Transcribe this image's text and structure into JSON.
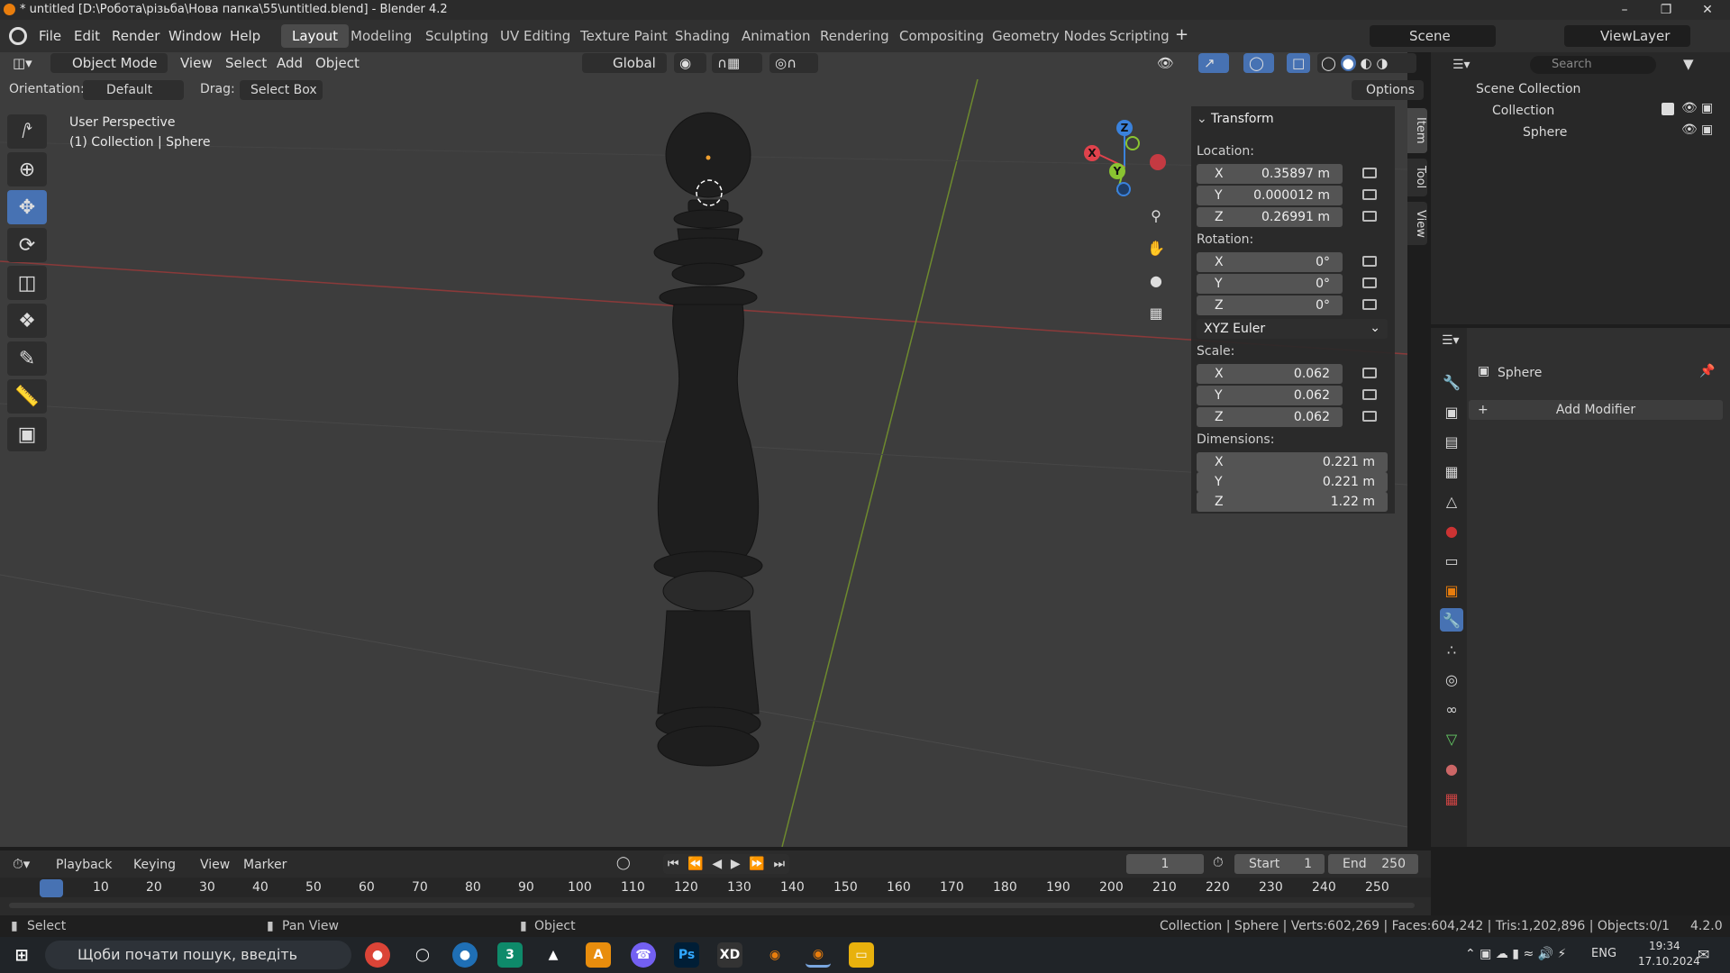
{
  "window": {
    "title": "* untitled [D:\\Робота\\різьба\\Нова папка\\55\\untitled.blend] - Blender 4.2",
    "min": "–",
    "max": "❐",
    "close": "✕"
  },
  "menu": [
    "File",
    "Edit",
    "Render",
    "Window",
    "Help"
  ],
  "workspaces": [
    "Layout",
    "Modeling",
    "Sculpting",
    "UV Editing",
    "Texture Paint",
    "Shading",
    "Animation",
    "Rendering",
    "Compositing",
    "Geometry Nodes",
    "Scripting"
  ],
  "add_tab": "+",
  "scene": {
    "label": "Scene",
    "view_layer": "ViewLayer"
  },
  "viewport_header": {
    "mode": "Object Mode",
    "view": "View",
    "select": "Select",
    "add": "Add",
    "object": "Object",
    "orientation": "Global"
  },
  "search_placeholder": "Search",
  "options_bar": {
    "orientation_label": "Orientation:",
    "orientation_value": "Default",
    "drag_label": "Drag:",
    "drag_value": "Select Box",
    "options": "Options"
  },
  "viewport": {
    "perspective": "User Perspective",
    "collection_info": "(1) Collection | Sphere"
  },
  "gizmo": {
    "x": "X",
    "y": "Y",
    "z": "Z"
  },
  "transform": {
    "title": "Transform",
    "location_label": "Location:",
    "location": {
      "x": "0.35897 m",
      "y": "0.000012 m",
      "z": "0.26991 m"
    },
    "rotation_label": "Rotation:",
    "rotation": {
      "x": "0°",
      "y": "0°",
      "z": "0°"
    },
    "rotation_mode": "XYZ Euler",
    "scale_label": "Scale:",
    "scale": {
      "x": "0.062",
      "y": "0.062",
      "z": "0.062"
    },
    "dimensions_label": "Dimensions:",
    "dimensions": {
      "x": "0.221 m",
      "y": "0.221 m",
      "z": "1.22 m"
    }
  },
  "side_tabs": [
    "Item",
    "Tool",
    "View"
  ],
  "outliner": {
    "root": "Scene Collection",
    "collection": "Collection",
    "object": "Sphere"
  },
  "properties": {
    "object_name": "Sphere",
    "add_modifier": "Add Modifier"
  },
  "timeline": {
    "playback": "Playback",
    "keying": "Keying",
    "view": "View",
    "marker": "Marker",
    "current_frame": "1",
    "start_label": "Start",
    "start": "1",
    "end_label": "End",
    "end": "250",
    "ticks": [
      "1",
      "10",
      "20",
      "30",
      "40",
      "50",
      "60",
      "70",
      "80",
      "90",
      "100",
      "110",
      "120",
      "130",
      "140",
      "150",
      "160",
      "170",
      "180",
      "190",
      "200",
      "210",
      "220",
      "230",
      "240",
      "250"
    ]
  },
  "status": {
    "select": "Select",
    "pan": "Pan View",
    "object": "Object",
    "stats": "Collection | Sphere | Verts:602,269 | Faces:604,242 | Tris:1,202,896 | Objects:0/1",
    "version": "4.2.0"
  },
  "taskbar": {
    "search": "Щоби почати пошук, введіть",
    "lang": "ENG",
    "time": "19:34",
    "date": "17.10.2024"
  },
  "colors": {
    "accent": "#4772b3",
    "x_axis": "#e0424c",
    "y_axis": "#8ac431",
    "z_axis": "#3a82dc"
  }
}
